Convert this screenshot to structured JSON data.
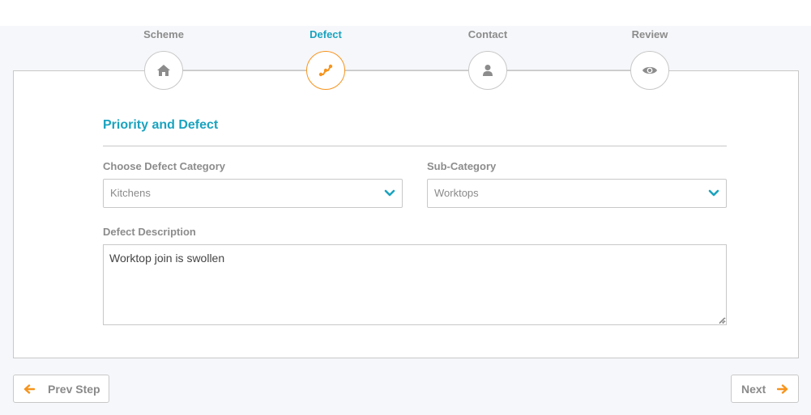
{
  "steps": [
    {
      "label": "Scheme",
      "icon": "home-icon",
      "active": false
    },
    {
      "label": "Defect",
      "icon": "defect-icon",
      "active": true
    },
    {
      "label": "Contact",
      "icon": "user-icon",
      "active": false
    },
    {
      "label": "Review",
      "icon": "eye-icon",
      "active": false
    }
  ],
  "form": {
    "section_title": "Priority and Defect",
    "category_label": "Choose Defect Category",
    "category_value": "Kitchens",
    "subcategory_label": "Sub-Category",
    "subcategory_value": "Worktops",
    "description_label": "Defect Description",
    "description_value": "Worktop join is swollen"
  },
  "buttons": {
    "prev_label": "Prev Step",
    "next_label": "Next"
  },
  "colors": {
    "accent_teal": "#1aa3bf",
    "accent_orange": "#f7941d",
    "muted_text": "#8c8c8c",
    "border": "#c8c8c8"
  }
}
